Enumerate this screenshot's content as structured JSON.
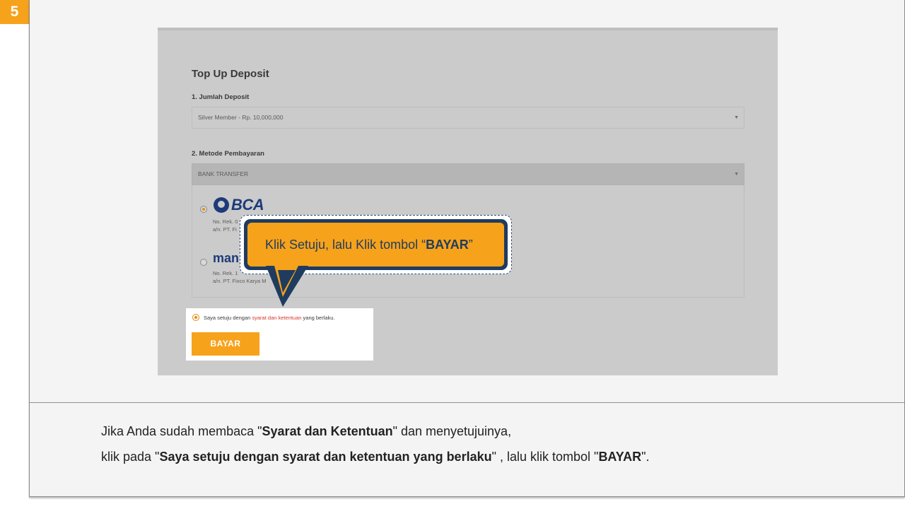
{
  "step": {
    "number": "5"
  },
  "form": {
    "title": "Top Up Deposit",
    "amount_label": "1. Jumlah Deposit",
    "amount_value": "Silver Member - Rp. 10,000,000",
    "method_label": "2. Metode Pembayaran",
    "method_value": "BANK TRANSFER",
    "dropdown_arrow": "▼",
    "banks": [
      {
        "name": "BCA",
        "line1": "No. Rek. 0",
        "line2": "a/n. PT. Fi",
        "selected": true
      },
      {
        "name": "man",
        "line1": "No. Rek. 1",
        "line2": "a/n. PT. Fixco Karya M",
        "selected": false
      }
    ],
    "agree": {
      "prefix": "Saya setuju dengan ",
      "link": "syarat dan ketentuan",
      "suffix": " yang berlaku.",
      "checked": true
    },
    "pay_label": "BAYAR"
  },
  "callout": {
    "prefix": "Klik Setuju, lalu  Klik tombol “",
    "bold": "BAYAR",
    "suffix": "”"
  },
  "instructions": {
    "line1": {
      "a": "Jika Anda sudah membaca \"",
      "b": "Syarat dan Ketentuan",
      "c": "\" dan menyetujuinya,"
    },
    "line2": {
      "a": "klik pada \"",
      "b": "Saya setuju dengan syarat dan ketentuan yang berlaku",
      "c": "\" , lalu klik tombol \"",
      "d": "BAYAR",
      "e": "\"."
    }
  },
  "colors": {
    "accent": "#f7a21b",
    "navy": "#1f3c5f",
    "link": "#d8362b",
    "bca_blue": "#1d3a7a"
  }
}
